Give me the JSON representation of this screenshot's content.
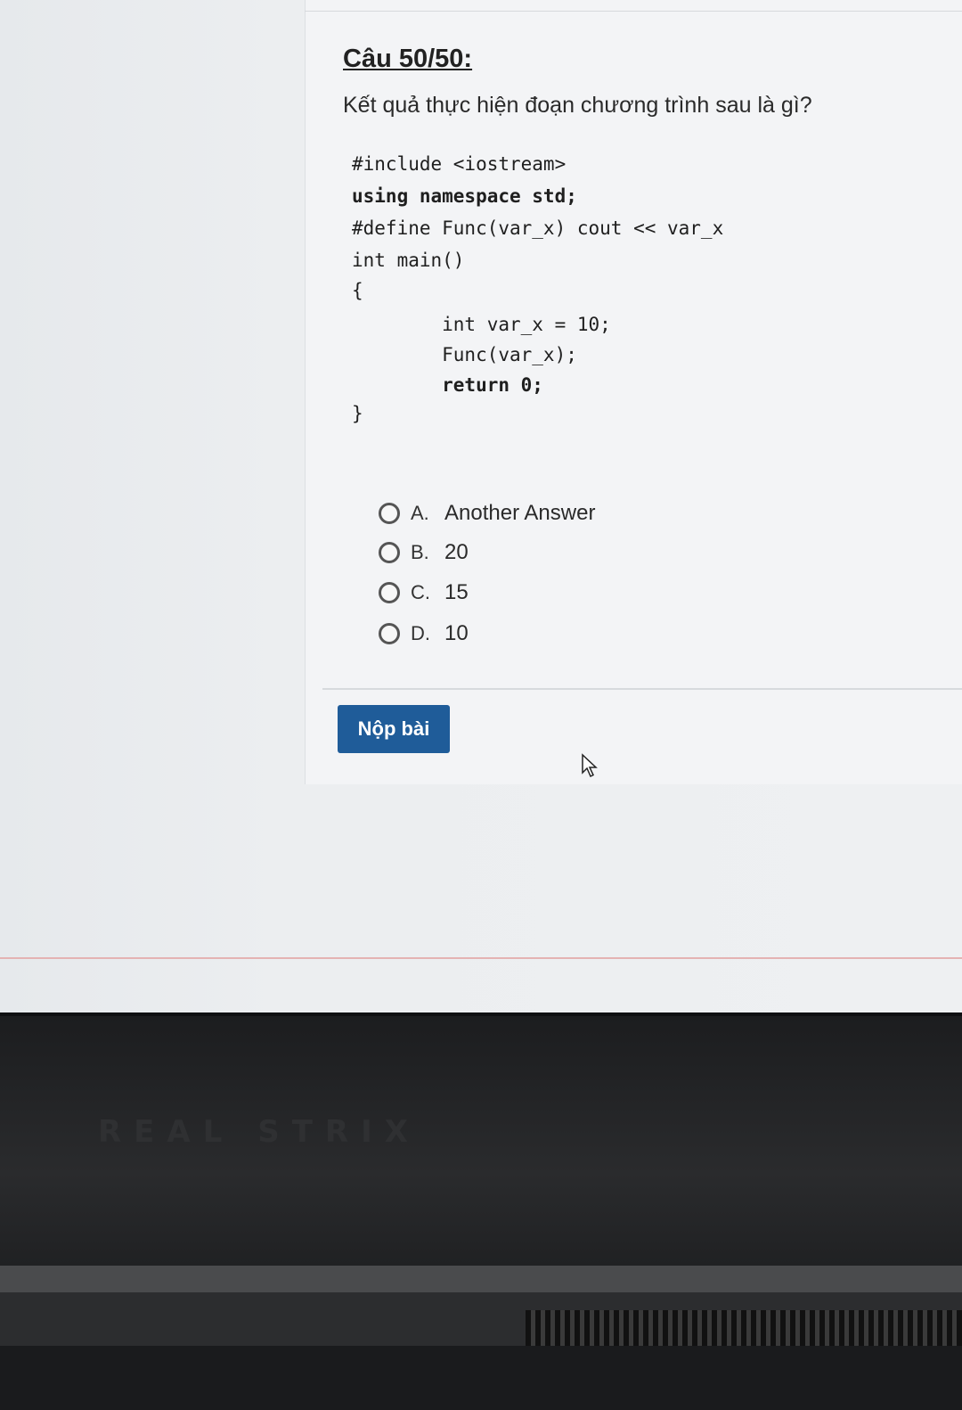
{
  "question": {
    "title": "Câu 50/50:",
    "text": "Kết quả thực hiện đoạn chương trình sau là gì?"
  },
  "code": {
    "lines": [
      "#include <iostream>",
      "using namespace std;",
      "#define Func(var_x) cout << var_x",
      "int main()",
      "{",
      "        int var_x = 10;",
      "        Func(var_x);",
      "        return 0;",
      "}"
    ]
  },
  "options": [
    {
      "letter": "A.",
      "text": "Another Answer"
    },
    {
      "letter": "B.",
      "text": "20"
    },
    {
      "letter": "C.",
      "text": "15"
    },
    {
      "letter": "D.",
      "text": "10"
    }
  ],
  "submit": {
    "label": "Nộp bài"
  },
  "laptop": {
    "brand": "REAL STRIX"
  },
  "icons": {
    "cursor": "mouse-pointer-icon"
  }
}
